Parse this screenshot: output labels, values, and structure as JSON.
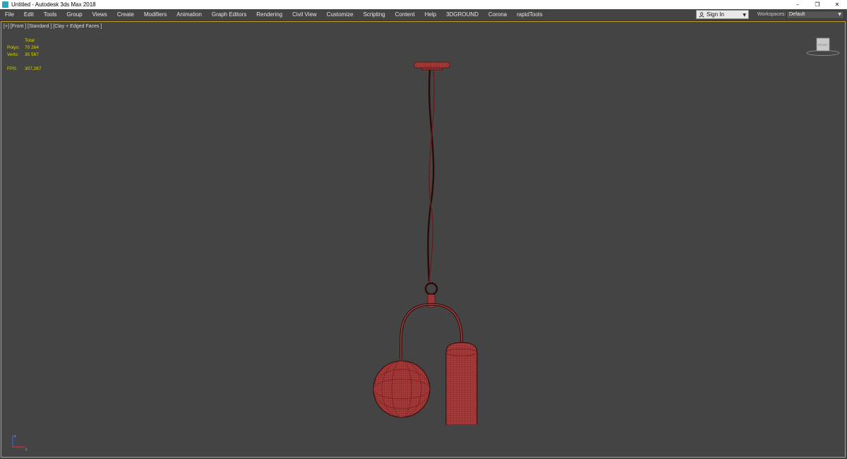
{
  "window": {
    "title": "Untitled - Autodesk 3ds Max 2018",
    "controls": [
      "–",
      "❐",
      "✕"
    ]
  },
  "menu": [
    {
      "label": "File"
    },
    {
      "label": "Edit"
    },
    {
      "label": "Tools"
    },
    {
      "label": "Group"
    },
    {
      "label": "Views"
    },
    {
      "label": "Create"
    },
    {
      "label": "Modifiers"
    },
    {
      "label": "Animation"
    },
    {
      "label": "Graph Editors"
    },
    {
      "label": "Rendering"
    },
    {
      "label": "Civil View"
    },
    {
      "label": "Customize"
    },
    {
      "label": "Scripting"
    },
    {
      "label": "Content"
    },
    {
      "label": "Help"
    },
    {
      "label": "3DGROUND"
    },
    {
      "label": "Corona"
    },
    {
      "label": "rapidTools"
    }
  ],
  "account": {
    "signin_label": "Sign In",
    "workspaces_label": "Workspaces:",
    "workspace_value": "Default"
  },
  "viewport": {
    "label": "[+] [Front ] [Standard ] [Clay + Edged Faces ]",
    "stats_header": "Total",
    "stats": [
      {
        "key": "Polys:",
        "value": "70 264"
      },
      {
        "key": "Verts:",
        "value": "35 567"
      }
    ],
    "fps_key": "FPS:",
    "fps_value": "307,267",
    "viewcube_label": "FRONT",
    "axis": {
      "x": "x",
      "z": "z"
    }
  },
  "colors": {
    "mesh": "#a83a3a",
    "wire": "#4a1212",
    "viewport_bg": "#444444",
    "active_border": "#c8a52a",
    "stats_text": "#d9d400"
  }
}
